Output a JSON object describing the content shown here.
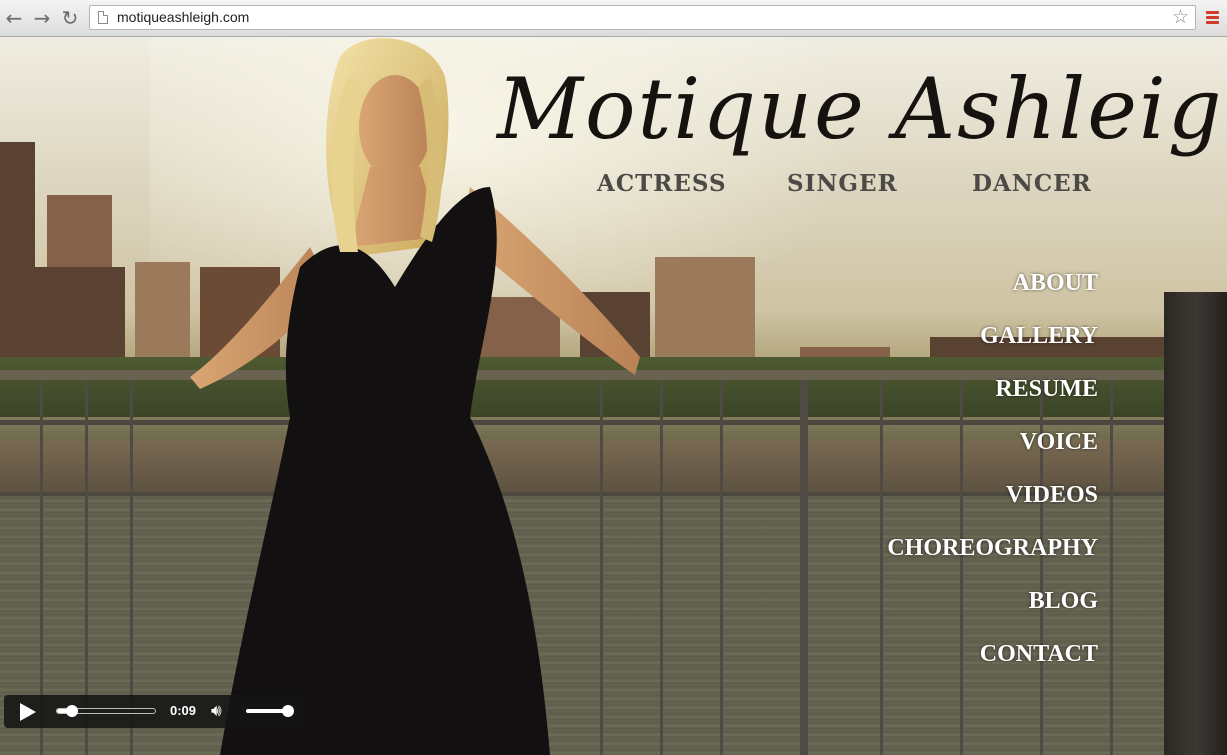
{
  "browser": {
    "url": "motiqueashleigh.com",
    "icons": [
      "back-arrow-icon",
      "forward-arrow-icon",
      "reload-icon",
      "page-icon",
      "star-icon",
      "menu-icon"
    ]
  },
  "site": {
    "title": "Motique Ashleigh",
    "roles": [
      "ACTRESS",
      "SINGER",
      "DANCER"
    ]
  },
  "nav": {
    "items": [
      "ABOUT",
      "GALLERY",
      "RESUME",
      "VOICE",
      "VIDEOS",
      "CHOREOGRAPHY",
      "BLOG",
      "CONTACT"
    ]
  },
  "player": {
    "time": "0:09",
    "progress": 0.1,
    "volume": 0.85
  },
  "colors": {
    "menu_accent": "#d23a2c",
    "nav_text": "#ffffff",
    "roles_text": "#4c4a47"
  }
}
